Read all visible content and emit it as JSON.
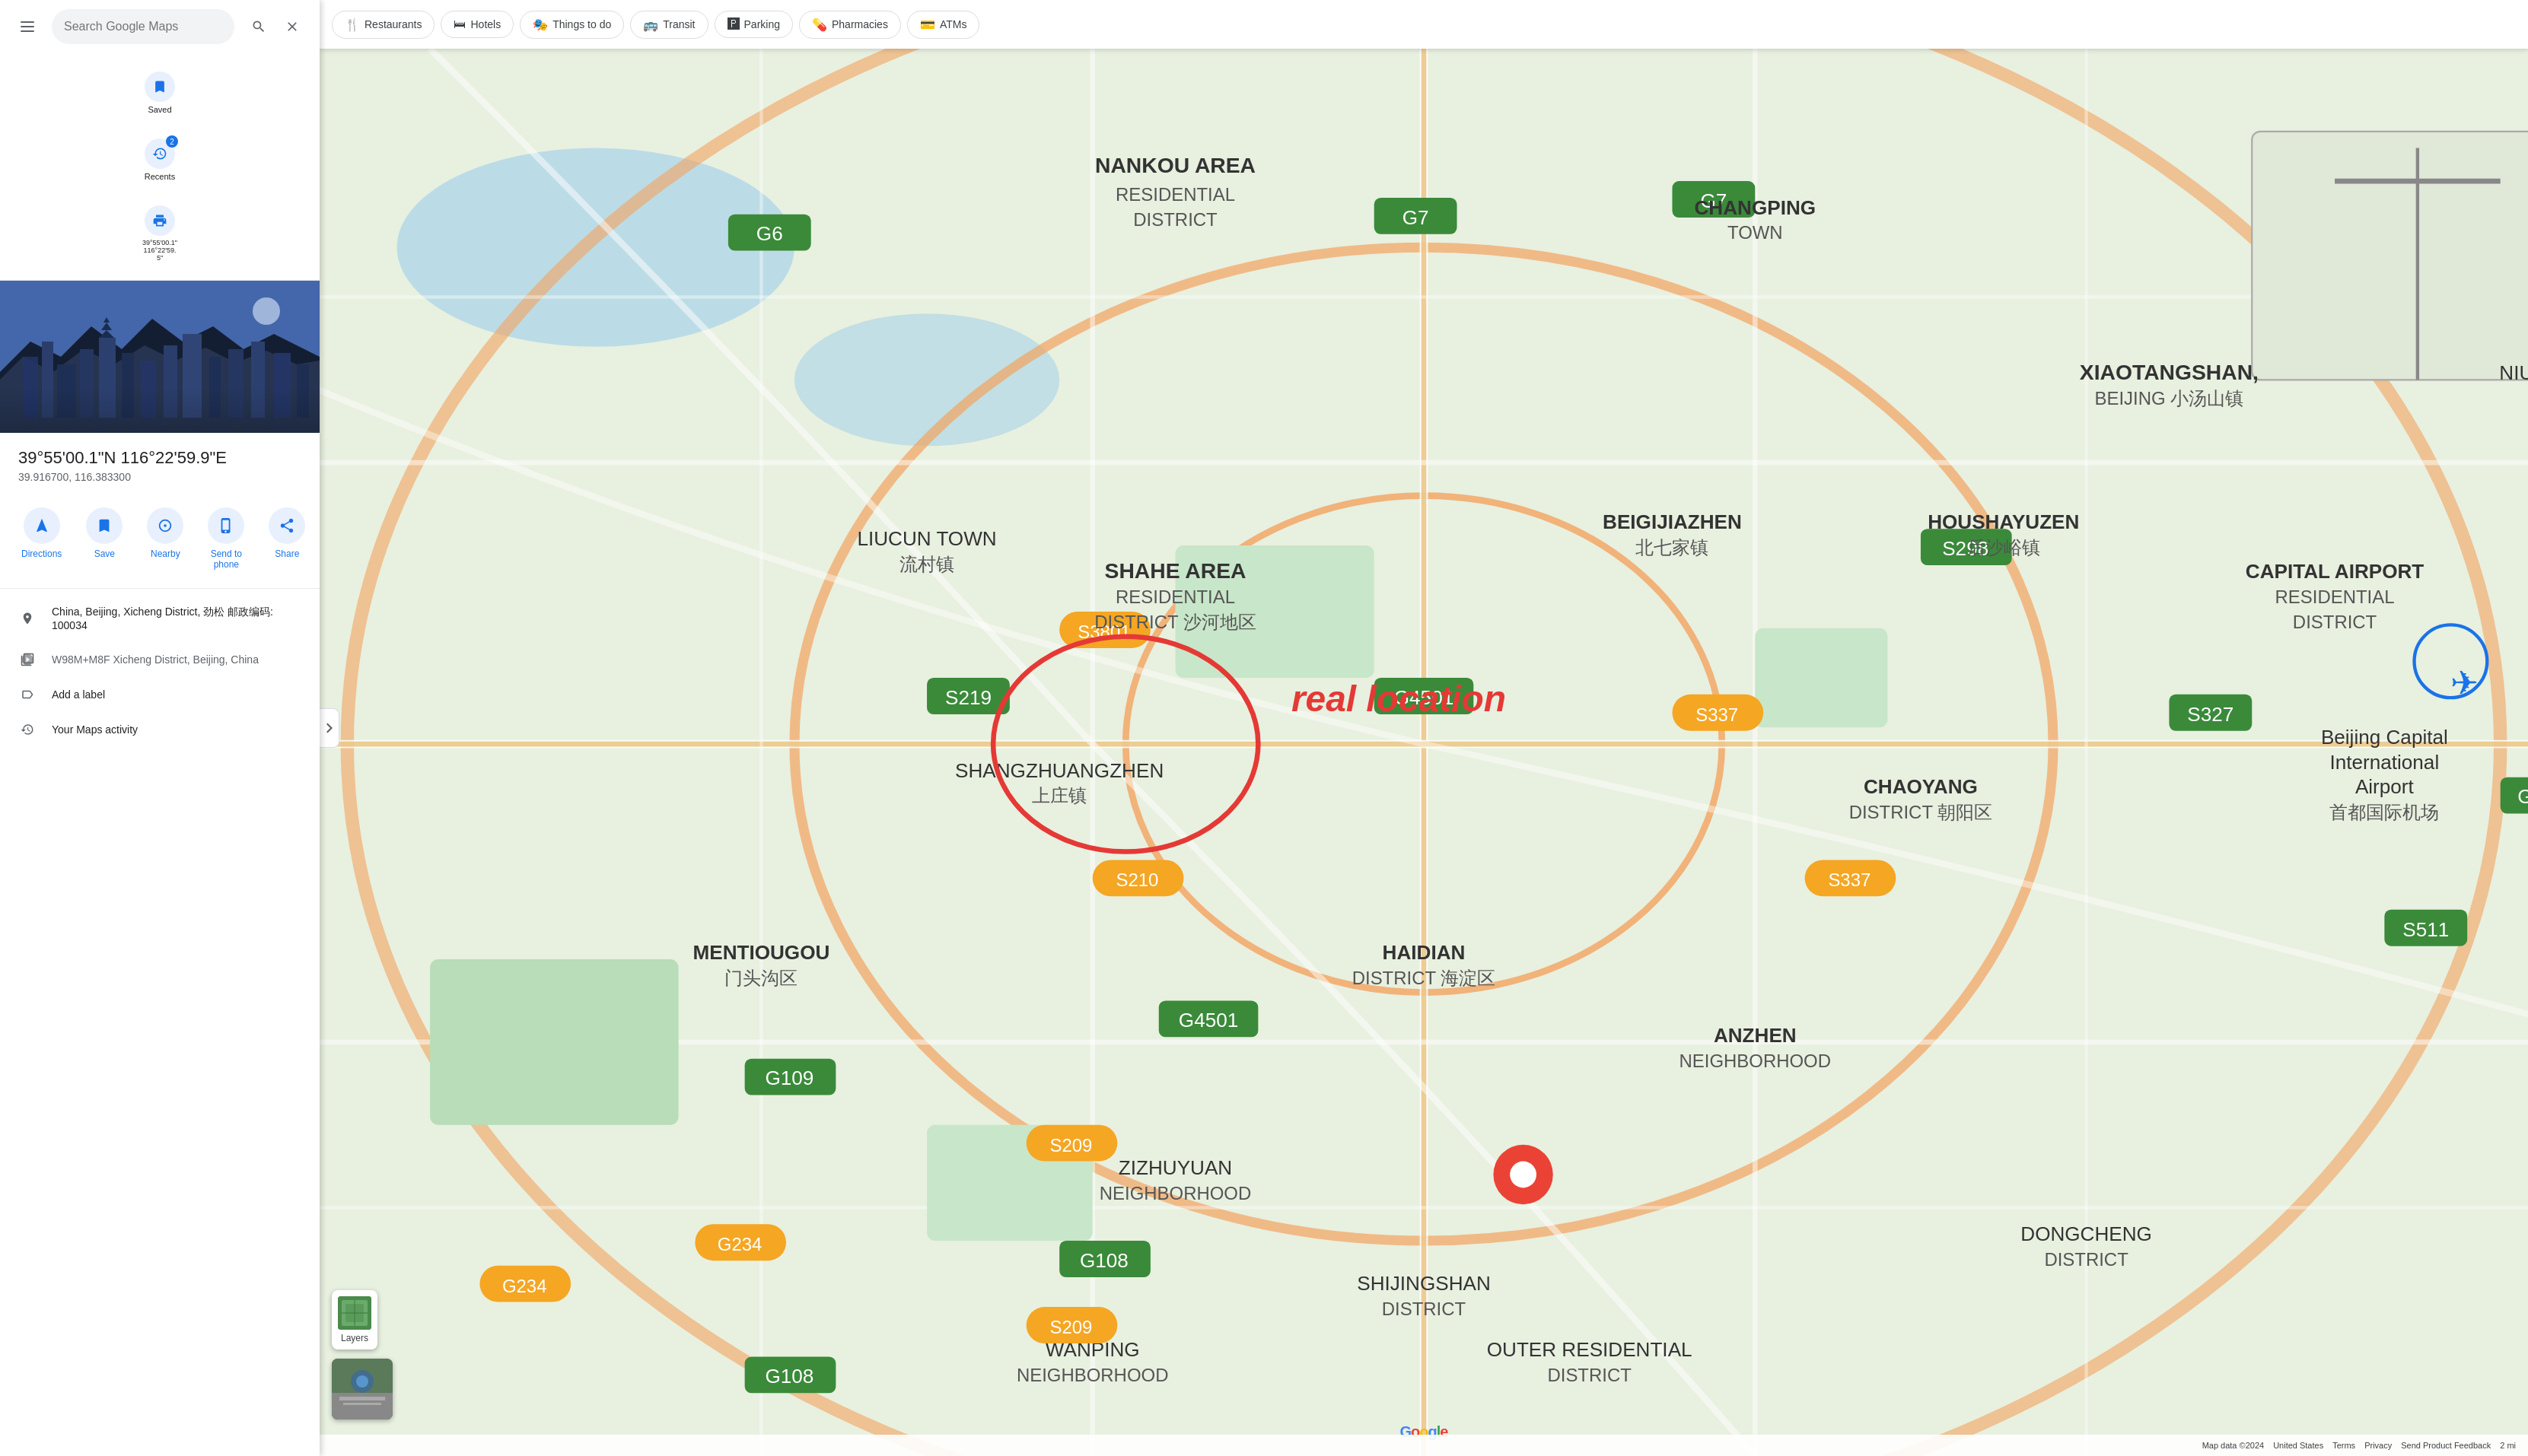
{
  "sidebar": {
    "search_value": "39°55'00.1\"N 116°22'59.9\"E",
    "search_placeholder": "Search Google Maps",
    "nav_items": [
      {
        "id": "saved",
        "label": "Saved",
        "icon": "🔖"
      },
      {
        "id": "recents",
        "label": "Recents",
        "icon": "🕐",
        "badge": "2"
      },
      {
        "id": "print",
        "label": "39°55'00.1\" 116°22'59.5\"",
        "icon": "🖨️"
      }
    ],
    "location": {
      "title": "39°55'00.1\"N 116°22'59.9\"E",
      "coords": "39.916700, 116.383300"
    },
    "action_buttons": [
      {
        "id": "directions",
        "label": "Directions",
        "icon": "➤"
      },
      {
        "id": "save",
        "label": "Save",
        "icon": "🔖"
      },
      {
        "id": "nearby",
        "label": "Nearby",
        "icon": "⊙"
      },
      {
        "id": "send-to-phone",
        "label": "Send to phone",
        "icon": "📱"
      },
      {
        "id": "share",
        "label": "Share",
        "icon": "↗"
      }
    ],
    "info_rows": [
      {
        "id": "address",
        "icon": "📍",
        "text": "China, Beijing, Xicheng District, 劲松 邮政编码: 100034",
        "secondary": false
      },
      {
        "id": "plus-code",
        "icon": "⊞",
        "text": "W98M+M8F Xicheng District, Beijing, China",
        "secondary": true
      },
      {
        "id": "add-label",
        "icon": "🏷",
        "text": "Add a label",
        "secondary": false
      },
      {
        "id": "maps-activity",
        "icon": "🕐",
        "text": "Your Maps activity",
        "secondary": false
      }
    ]
  },
  "map": {
    "filter_buttons": [
      {
        "id": "restaurants",
        "label": "Restaurants",
        "icon": "🍴"
      },
      {
        "id": "hotels",
        "label": "Hotels",
        "icon": "🛏"
      },
      {
        "id": "things-to-do",
        "label": "Things to do",
        "icon": "🎭"
      },
      {
        "id": "transit",
        "label": "Transit",
        "icon": "🚌"
      },
      {
        "id": "parking",
        "label": "Parking",
        "icon": "🅿"
      },
      {
        "id": "pharmacies",
        "label": "Pharmacies",
        "icon": "💊"
      },
      {
        "id": "atms",
        "label": "ATMs",
        "icon": "💳"
      }
    ],
    "layers_label": "Layers",
    "bottom_bar": {
      "map_data": "Map data ©2024",
      "country": "United States",
      "terms": "Terms",
      "privacy": "Privacy",
      "send_feedback": "Send Product Feedback",
      "scale": "2 mi"
    }
  }
}
